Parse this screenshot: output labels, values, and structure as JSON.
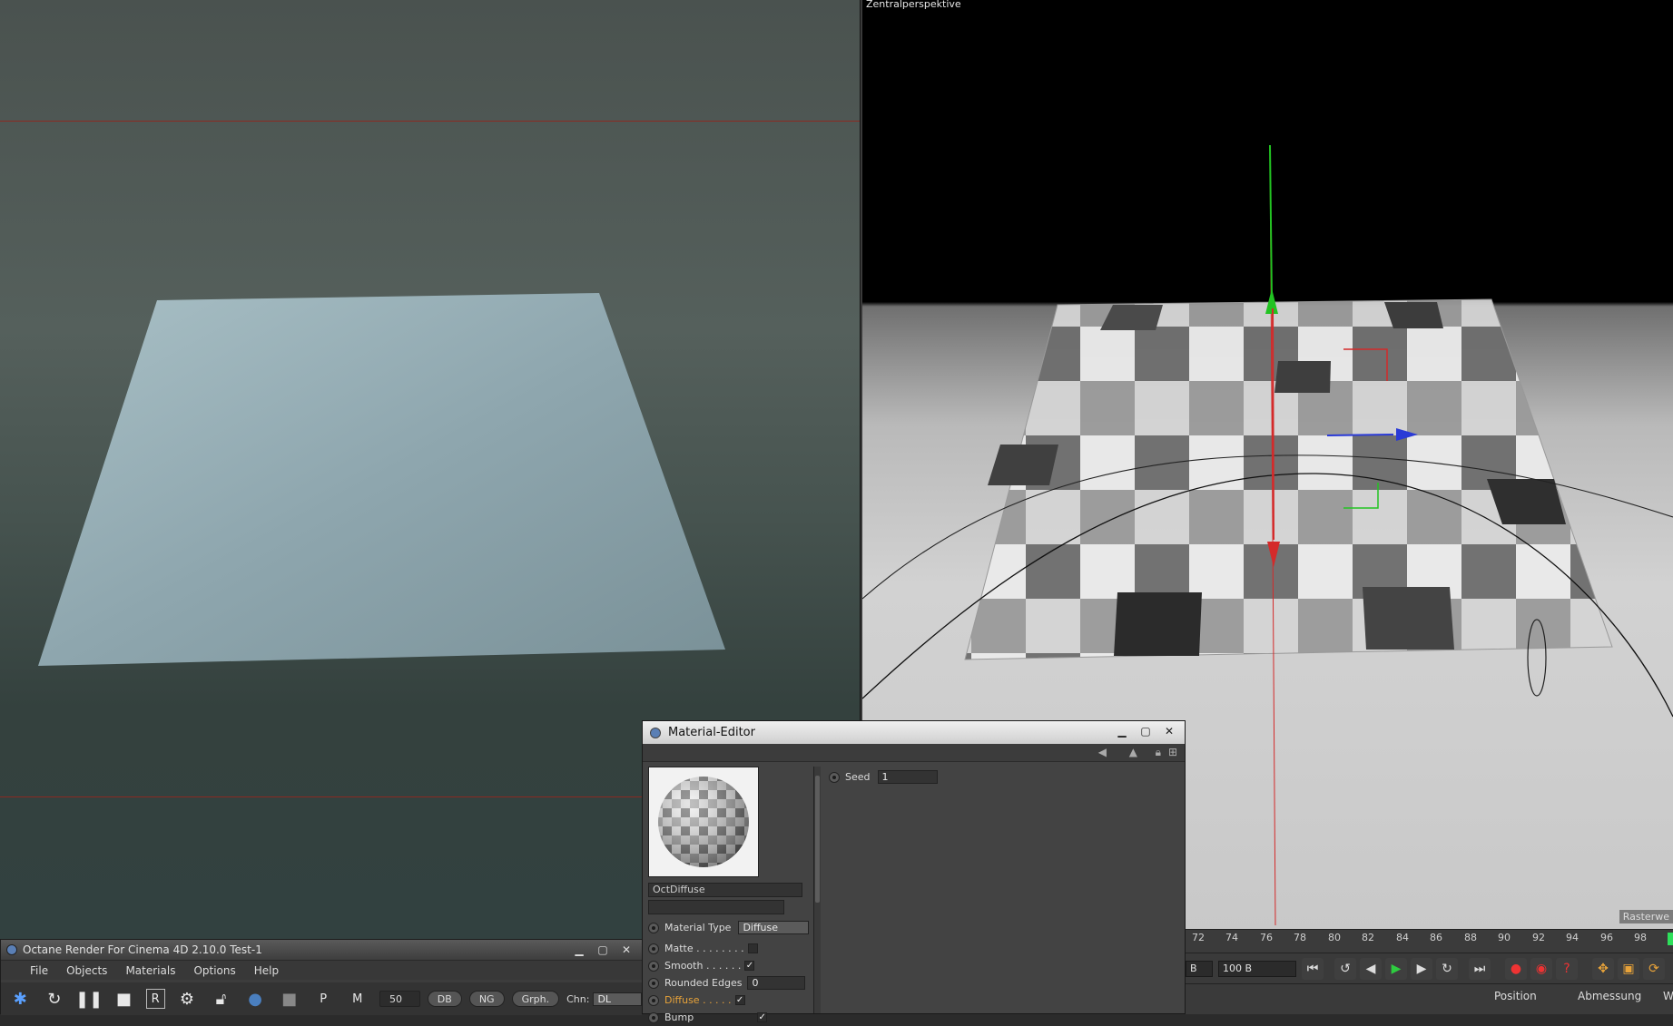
{
  "viewport": {
    "label": "Zentralperspektive",
    "raster_label": "Rasterwe"
  },
  "timeline": {
    "ticks": [
      "72",
      "74",
      "76",
      "78",
      "80",
      "82",
      "84",
      "86",
      "88",
      "90",
      "92",
      "94",
      "96",
      "98"
    ],
    "start_field": "B",
    "end_field": "100 B"
  },
  "coords": {
    "position": "Position",
    "size": "Abmessung",
    "third": "W"
  },
  "octane": {
    "title": "Octane Render For Cinema 4D 2.10.0 Test-1",
    "menu": [
      "File",
      "Objects",
      "Materials",
      "Options",
      "Help"
    ],
    "samples": "50",
    "pills": [
      "DB",
      "NG",
      "Grph."
    ],
    "channel_label": "Chn:",
    "channel_value": "DL",
    "buttons": [
      "octane-logo-icon",
      "refresh-icon",
      "pause-icon",
      "stop-icon",
      "R",
      "gear-icon",
      "lock-icon",
      "sphere-icon",
      "square-icon",
      "P",
      "M"
    ]
  },
  "material_editor": {
    "title": "Material-Editor",
    "material_name": "OctDiffuse",
    "seed_label": "Seed",
    "seed_value": "1",
    "material_type_label": "Material Type",
    "material_type_value": "Diffuse",
    "rows": [
      {
        "label": "Matte . . . . . . . .",
        "checked": false
      },
      {
        "label": "Smooth . . . . . .",
        "checked": true
      },
      {
        "label": "Rounded Edges",
        "value": "0"
      },
      {
        "label": "Diffuse . . . . .",
        "checked": true,
        "active": true
      },
      {
        "label": "Bump",
        "checked": true
      }
    ]
  },
  "colors": {
    "accent_orange": "#e8a33a",
    "axis_green": "#22c322",
    "axis_red": "#d42a2a",
    "axis_blue": "#2a3ad6",
    "timeline_marker": "#2ee05b"
  }
}
